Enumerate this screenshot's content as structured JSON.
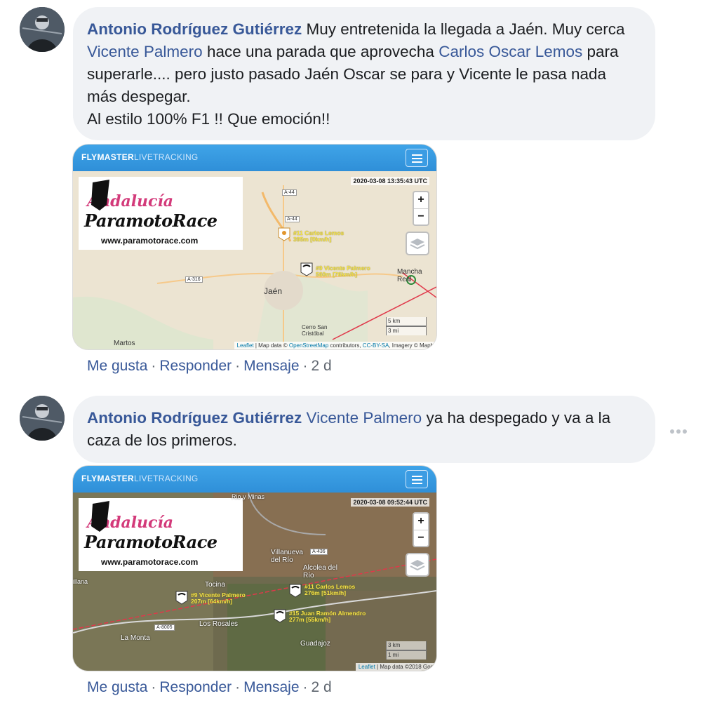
{
  "comments": [
    {
      "author": "Antonio Rodríguez Gutiérrez",
      "text_parts": {
        "p1": " Muy entretenida la llegada a Jaén. Muy cerca ",
        "m1": "Vicente Palmero",
        "p2": " hace una parada que aprovecha ",
        "m2": "Carlos Oscar Lemos",
        "p3": " para superarle.... pero justo pasado Jaén Oscar se para y Vicente le pasa nada más despegar.",
        "p4": "Al estilo 100% F1 !! Que emoción!!"
      },
      "map": {
        "brand": "FLYMASTER",
        "brand_sub": "LIVETRACKING",
        "logo_line1": "Andalucía",
        "logo_line2": "ParamotoRace",
        "logo_url": "www.paramotorace.com",
        "timestamp": "2020-03-08 13:35:43 UTC",
        "places": [
          "Jaén",
          "Mancha Real",
          "Martos",
          "Cerro San Cristóbal"
        ],
        "roads": [
          "A-44",
          "A-44",
          "A-316"
        ],
        "pilots": [
          {
            "label1": "#11 Carlos Lemos",
            "label2": "395m [0km/h]"
          },
          {
            "label1": "#9 Vicente Palmero",
            "label2": "560m [76km/h]"
          }
        ],
        "scale_km": "5 km",
        "scale_mi": "3 mi",
        "attribution_link": "Leaflet",
        "attribution_text": " | Map data © ",
        "attribution_osm": "OpenStreetMap",
        "attribution_rest": " contributors, ",
        "attribution_cc": "CC-BY-SA",
        "attribution_end": ", Imagery © Mapb"
      },
      "actions": {
        "like": "Me gusta",
        "reply": "Responder",
        "message": "Mensaje",
        "time": "2 d"
      }
    },
    {
      "author": "Antonio Rodríguez Gutiérrez",
      "text_parts": {
        "m1": "Vicente Palmero",
        "p1": " ya ha despegado y va a la caza de los primeros."
      },
      "map": {
        "brand": "FLYMASTER",
        "brand_sub": "LIVETRACKING",
        "logo_line1": "Andalucía",
        "logo_line2": "ParamotoRace",
        "logo_url": "www.paramotorace.com",
        "timestamp": "2020-03-08 09:52:44 UTC",
        "places": [
          "Villanueva del Río",
          "Alcolea del Río",
          "Tocina",
          "Los Rosales",
          "La Monta",
          "Guadajoz",
          "Rio y Minas",
          "illana"
        ],
        "roads": [
          "A-436",
          "A-8005"
        ],
        "pilots": [
          {
            "label1": "#9 Vicente Palmero",
            "label2": "207m [64km/h]"
          },
          {
            "label1": "#11 Carlos Lemos",
            "label2": "276m [51km/h]"
          },
          {
            "label1": "#15 Juan Ramón Almendro",
            "label2": "277m [55km/h]"
          }
        ],
        "scale_km": "3 km",
        "scale_mi": "1 mi",
        "attribution_link": "Leaflet",
        "attribution_text": " | Map data ©2018 Goo"
      },
      "actions": {
        "like": "Me gusta",
        "reply": "Responder",
        "message": "Mensaje",
        "time": "2 d"
      }
    }
  ],
  "colors": {
    "link": "#385898",
    "bubble": "#f0f2f5",
    "map_bar": "#2f8fd8",
    "track": "#e0384a"
  }
}
